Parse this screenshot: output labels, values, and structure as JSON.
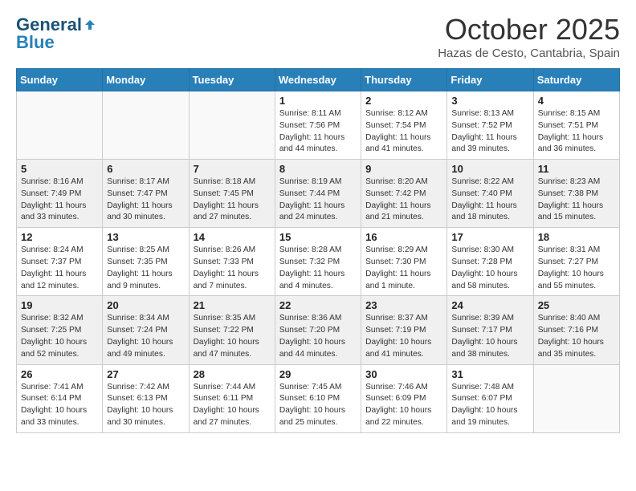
{
  "header": {
    "logo_general": "General",
    "logo_blue": "Blue",
    "month_title": "October 2025",
    "location": "Hazas de Cesto, Cantabria, Spain"
  },
  "weekdays": [
    "Sunday",
    "Monday",
    "Tuesday",
    "Wednesday",
    "Thursday",
    "Friday",
    "Saturday"
  ],
  "weeks": [
    [
      {
        "day": "",
        "info": ""
      },
      {
        "day": "",
        "info": ""
      },
      {
        "day": "",
        "info": ""
      },
      {
        "day": "1",
        "info": "Sunrise: 8:11 AM\nSunset: 7:56 PM\nDaylight: 11 hours\nand 44 minutes."
      },
      {
        "day": "2",
        "info": "Sunrise: 8:12 AM\nSunset: 7:54 PM\nDaylight: 11 hours\nand 41 minutes."
      },
      {
        "day": "3",
        "info": "Sunrise: 8:13 AM\nSunset: 7:52 PM\nDaylight: 11 hours\nand 39 minutes."
      },
      {
        "day": "4",
        "info": "Sunrise: 8:15 AM\nSunset: 7:51 PM\nDaylight: 11 hours\nand 36 minutes."
      }
    ],
    [
      {
        "day": "5",
        "info": "Sunrise: 8:16 AM\nSunset: 7:49 PM\nDaylight: 11 hours\nand 33 minutes."
      },
      {
        "day": "6",
        "info": "Sunrise: 8:17 AM\nSunset: 7:47 PM\nDaylight: 11 hours\nand 30 minutes."
      },
      {
        "day": "7",
        "info": "Sunrise: 8:18 AM\nSunset: 7:45 PM\nDaylight: 11 hours\nand 27 minutes."
      },
      {
        "day": "8",
        "info": "Sunrise: 8:19 AM\nSunset: 7:44 PM\nDaylight: 11 hours\nand 24 minutes."
      },
      {
        "day": "9",
        "info": "Sunrise: 8:20 AM\nSunset: 7:42 PM\nDaylight: 11 hours\nand 21 minutes."
      },
      {
        "day": "10",
        "info": "Sunrise: 8:22 AM\nSunset: 7:40 PM\nDaylight: 11 hours\nand 18 minutes."
      },
      {
        "day": "11",
        "info": "Sunrise: 8:23 AM\nSunset: 7:38 PM\nDaylight: 11 hours\nand 15 minutes."
      }
    ],
    [
      {
        "day": "12",
        "info": "Sunrise: 8:24 AM\nSunset: 7:37 PM\nDaylight: 11 hours\nand 12 minutes."
      },
      {
        "day": "13",
        "info": "Sunrise: 8:25 AM\nSunset: 7:35 PM\nDaylight: 11 hours\nand 9 minutes."
      },
      {
        "day": "14",
        "info": "Sunrise: 8:26 AM\nSunset: 7:33 PM\nDaylight: 11 hours\nand 7 minutes."
      },
      {
        "day": "15",
        "info": "Sunrise: 8:28 AM\nSunset: 7:32 PM\nDaylight: 11 hours\nand 4 minutes."
      },
      {
        "day": "16",
        "info": "Sunrise: 8:29 AM\nSunset: 7:30 PM\nDaylight: 11 hours\nand 1 minute."
      },
      {
        "day": "17",
        "info": "Sunrise: 8:30 AM\nSunset: 7:28 PM\nDaylight: 10 hours\nand 58 minutes."
      },
      {
        "day": "18",
        "info": "Sunrise: 8:31 AM\nSunset: 7:27 PM\nDaylight: 10 hours\nand 55 minutes."
      }
    ],
    [
      {
        "day": "19",
        "info": "Sunrise: 8:32 AM\nSunset: 7:25 PM\nDaylight: 10 hours\nand 52 minutes."
      },
      {
        "day": "20",
        "info": "Sunrise: 8:34 AM\nSunset: 7:24 PM\nDaylight: 10 hours\nand 49 minutes."
      },
      {
        "day": "21",
        "info": "Sunrise: 8:35 AM\nSunset: 7:22 PM\nDaylight: 10 hours\nand 47 minutes."
      },
      {
        "day": "22",
        "info": "Sunrise: 8:36 AM\nSunset: 7:20 PM\nDaylight: 10 hours\nand 44 minutes."
      },
      {
        "day": "23",
        "info": "Sunrise: 8:37 AM\nSunset: 7:19 PM\nDaylight: 10 hours\nand 41 minutes."
      },
      {
        "day": "24",
        "info": "Sunrise: 8:39 AM\nSunset: 7:17 PM\nDaylight: 10 hours\nand 38 minutes."
      },
      {
        "day": "25",
        "info": "Sunrise: 8:40 AM\nSunset: 7:16 PM\nDaylight: 10 hours\nand 35 minutes."
      }
    ],
    [
      {
        "day": "26",
        "info": "Sunrise: 7:41 AM\nSunset: 6:14 PM\nDaylight: 10 hours\nand 33 minutes."
      },
      {
        "day": "27",
        "info": "Sunrise: 7:42 AM\nSunset: 6:13 PM\nDaylight: 10 hours\nand 30 minutes."
      },
      {
        "day": "28",
        "info": "Sunrise: 7:44 AM\nSunset: 6:11 PM\nDaylight: 10 hours\nand 27 minutes."
      },
      {
        "day": "29",
        "info": "Sunrise: 7:45 AM\nSunset: 6:10 PM\nDaylight: 10 hours\nand 25 minutes."
      },
      {
        "day": "30",
        "info": "Sunrise: 7:46 AM\nSunset: 6:09 PM\nDaylight: 10 hours\nand 22 minutes."
      },
      {
        "day": "31",
        "info": "Sunrise: 7:48 AM\nSunset: 6:07 PM\nDaylight: 10 hours\nand 19 minutes."
      },
      {
        "day": "",
        "info": ""
      }
    ]
  ]
}
